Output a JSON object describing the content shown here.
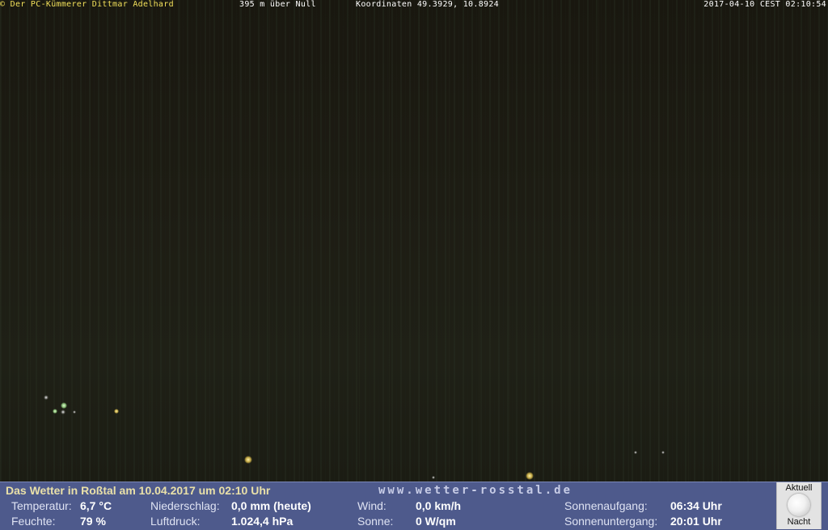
{
  "overlay": {
    "copyright": "© Der PC-Kümmerer Dittmar Adelhard",
    "altitude": "395 m über Null",
    "coordinates": "Koordinaten 49.3929, 10.8924",
    "datetime": "2017-04-10 CEST 02:10:54"
  },
  "weather": {
    "headline": "Das Wetter in Roßtal am 10.04.2017 um 02:10 Uhr",
    "site": "www.wetter-rosstal.de",
    "temperature": {
      "label": "Temperatur:",
      "value": "6,7 °C"
    },
    "humidity": {
      "label": "Feuchte:",
      "value": "79 %"
    },
    "precipitation": {
      "label": "Niederschlag:",
      "value": "0,0 mm (heute)"
    },
    "pressure": {
      "label": "Luftdruck:",
      "value": "1.024,4 hPa"
    },
    "wind": {
      "label": "Wind:",
      "value": "0,0 km/h"
    },
    "sun": {
      "label": "Sonne:",
      "value": "0 W/qm"
    },
    "sunrise": {
      "label": "Sonnenaufgang:",
      "value": "06:34 Uhr"
    },
    "sunset": {
      "label": "Sonnenuntergang:",
      "value": "20:01 Uhr"
    },
    "moon": {
      "top_label": "Aktuell",
      "bottom_label": "Nacht",
      "icon": "moon-icon"
    }
  },
  "colors": {
    "panel_bg": "#4e5a8c",
    "headline": "#e9e0a8",
    "copyright": "#f2e05a"
  }
}
